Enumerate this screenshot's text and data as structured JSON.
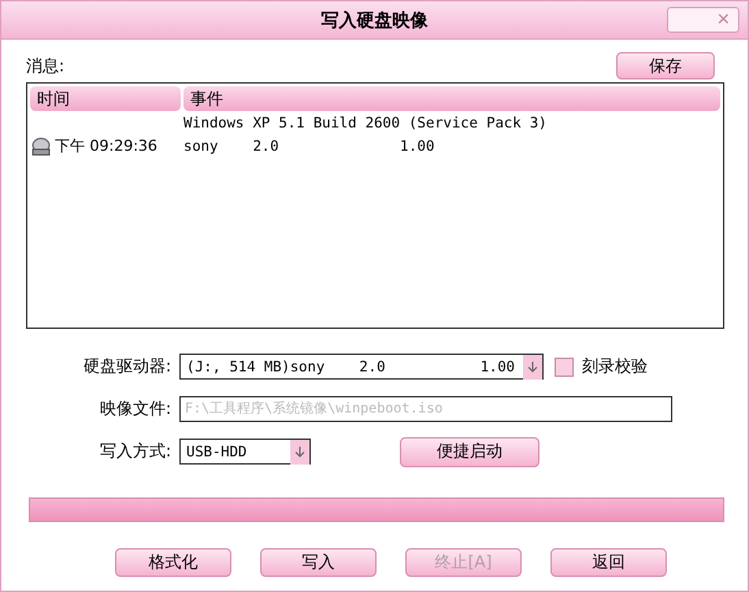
{
  "window": {
    "title": "写入硬盘映像",
    "close": "×"
  },
  "messages": {
    "label": "消息:",
    "save_button": "保存",
    "columns": [
      "时间",
      "事件"
    ],
    "rows": [
      {
        "time": "",
        "event": "Windows XP 5.1 Build 2600 (Service Pack 3)",
        "icon": false
      },
      {
        "time": "下午 09:29:36",
        "event": "sony    2.0              1.00",
        "icon": true
      }
    ]
  },
  "form": {
    "drive_label": "硬盘驱动器:",
    "drive_value": "(J:, 514 MB)sony    2.0",
    "drive_extra": "1.00",
    "verify": {
      "label": "刻录校验",
      "checked": false
    },
    "image_label": "映像文件:",
    "image_placeholder": "F:\\工具程序\\系统镜像\\winpeboot.iso",
    "mode_label": "写入方式:",
    "mode_value": "USB-HDD",
    "quick_button": "便捷启动"
  },
  "progress": {
    "level": 1
  },
  "buttons": [
    {
      "label": "格式化",
      "disabled": false
    },
    {
      "label": "写入",
      "disabled": false
    },
    {
      "label": "终止[A]",
      "disabled": true
    },
    {
      "label": "返回",
      "disabled": false
    }
  ]
}
